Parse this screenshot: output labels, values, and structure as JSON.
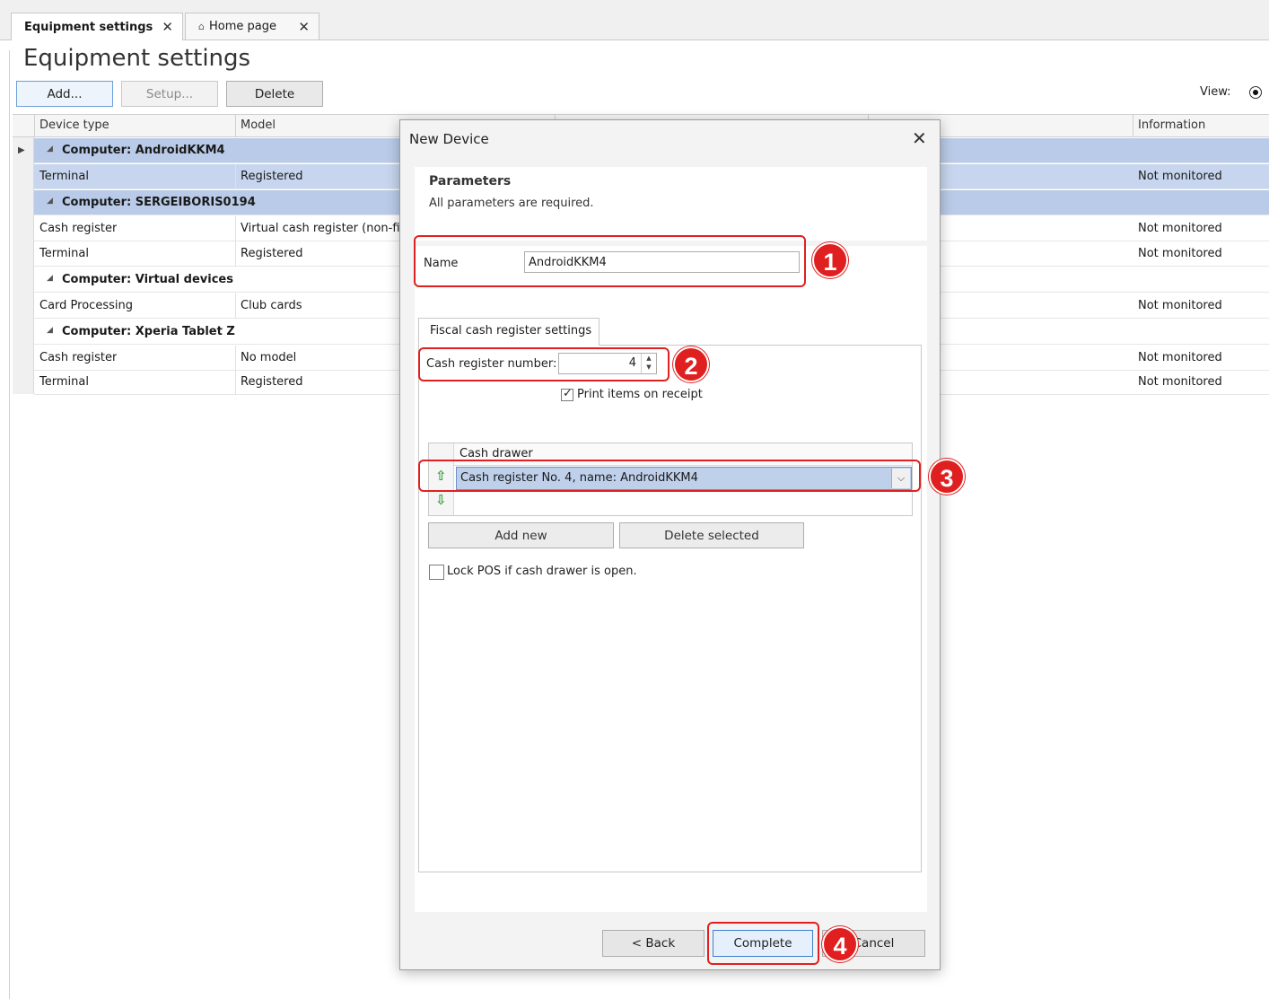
{
  "tabs": [
    {
      "label": "Equipment settings",
      "close": "✕"
    },
    {
      "label": "Home page",
      "close": "✕"
    }
  ],
  "page": {
    "title": "Equipment settings"
  },
  "toolbar": {
    "add": "Add...",
    "setup": "Setup...",
    "delete": "Delete",
    "view_label": "View:"
  },
  "grid": {
    "headers": {
      "device_type": "Device type",
      "model": "Model",
      "information": "Information"
    },
    "rows": [
      {
        "group": "Computer: AndroidKKM4"
      },
      {
        "device": "Terminal",
        "model": "Registered",
        "info": "Not monitored"
      },
      {
        "group": "Computer: SERGEIBORIS0194"
      },
      {
        "device": "Cash register",
        "model": "Virtual cash register (non-fise",
        "info": "Not monitored"
      },
      {
        "device": "Terminal",
        "model": "Registered",
        "info": "Not monitored"
      },
      {
        "group": "Computer: Virtual devices"
      },
      {
        "device": "Card Processing",
        "model": "Club cards",
        "info": "Not monitored"
      },
      {
        "group": "Computer: Xperia Tablet Z"
      },
      {
        "device": "Cash register",
        "model": "No model",
        "info": "Not monitored"
      },
      {
        "device": "Terminal",
        "model": "Registered",
        "info": "Not monitored"
      }
    ]
  },
  "modal": {
    "title": "New Device",
    "params_title": "Parameters",
    "params_sub": "All parameters are required.",
    "name_label": "Name",
    "name_value": "AndroidKKM4",
    "fiscal_tab": "Fiscal cash register settings",
    "cash_number_label": "Cash register number:",
    "cash_number_value": "4",
    "print_items_label": "Print items on receipt",
    "print_items_checked": true,
    "drawer_header": "Cash drawer",
    "drawer_selected": "Cash register No. 4, name: AndroidKKM4",
    "add_new": "Add new",
    "delete_selected": "Delete selected",
    "lock_pos_label": "Lock POS if cash drawer is open.",
    "lock_pos_checked": false,
    "back": "< Back",
    "complete": "Complete",
    "cancel": "Cancel"
  },
  "annotations": [
    "1",
    "2",
    "3",
    "4"
  ],
  "icons": {
    "close": "close-icon",
    "home": "home-icon",
    "up": "arrow-up-icon",
    "down": "arrow-down-icon",
    "dropdown": "chevron-down-icon"
  },
  "colors": {
    "highlight": "#e02020",
    "selection": "#c7d6ee"
  }
}
